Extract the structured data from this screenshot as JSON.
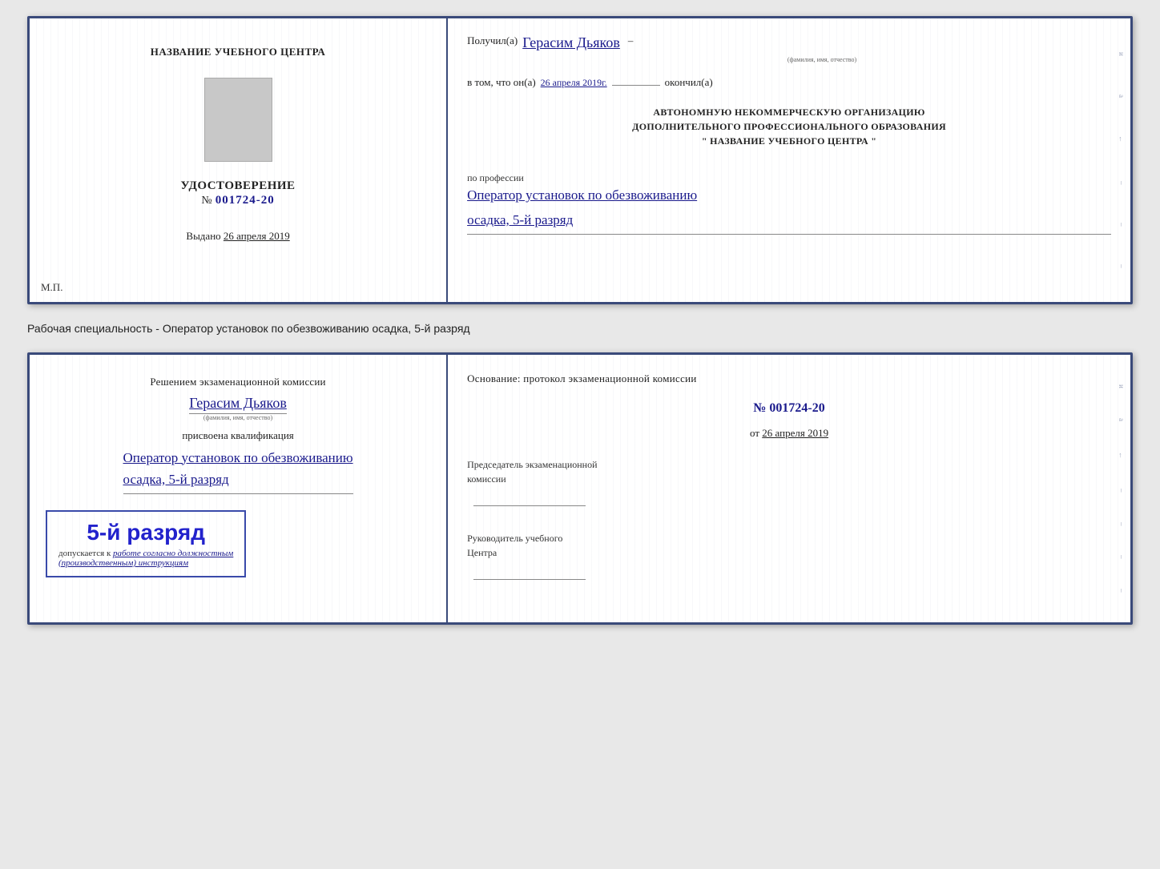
{
  "cert1": {
    "left": {
      "school_name": "НАЗВАНИЕ УЧЕБНОГО ЦЕНТРА",
      "photo_placeholder": "",
      "udostoverenie_label": "УДОСТОВЕРЕНИЕ",
      "number_prefix": "№",
      "number": "001724-20",
      "vydano_label": "Выдано",
      "vydano_date": "26 апреля 2019",
      "mp_label": "М.П."
    },
    "right": {
      "received_label": "Получил(а)",
      "fio_handwritten": "Герасим Дьяков",
      "fio_sub": "(фамилия, имя, отчество)",
      "dash": "–",
      "vtom_label": "в том, что он(а)",
      "date_handwritten": "26 апреля 2019г.",
      "okончил_label": "окончил(а)",
      "autonomous_line1": "АВТОНОМНУЮ НЕКОММЕРЧЕСКУЮ ОРГАНИЗАЦИЮ",
      "autonomous_line2": "ДОПОЛНИТЕЛЬНОГО ПРОФЕССИОНАЛЬНОГО ОБРАЗОВАНИЯ",
      "autonomous_line3": "\" НАЗВАНИЕ УЧЕБНОГО ЦЕНТРА \"",
      "po_professii_label": "по профессии",
      "profession_handwritten1": "Оператор установок по обезвоживанию",
      "profession_handwritten2": "осадка, 5-й разряд"
    }
  },
  "separator": {
    "text": "Рабочая специальность - Оператор установок по обезвоживанию осадка, 5-й разряд"
  },
  "cert2": {
    "left": {
      "decision_label": "Решением экзаменационной комиссии",
      "fio_handwritten": "Герасим Дьяков",
      "fio_sub": "(фамилия, имя, отчество)",
      "prisvoyena_label": "присвоена квалификация",
      "qualification_handwritten1": "Оператор установок по обезвоживанию",
      "qualification_handwritten2": "осадка, 5-й разряд",
      "rank_big": "5-й разряд",
      "dopuskaetsya_label": "допускается к",
      "work_italic": "работе согласно должностным",
      "work_italic2": "(производственным) инструкциям"
    },
    "right": {
      "osnovanie_label": "Основание: протокол экзаменационной комиссии",
      "number_handwritten": "№ 001724-20",
      "ot_label": "от",
      "date_value": "26 апреля 2019",
      "predsedatel_line1": "Председатель экзаменационной",
      "predsedatel_line2": "комиссии",
      "rukovoditel_line1": "Руководитель учебного",
      "rukovoditel_line2": "Центра"
    }
  },
  "right_decorations": [
    "и",
    "a",
    "←",
    "–",
    "–",
    "–",
    "–"
  ]
}
